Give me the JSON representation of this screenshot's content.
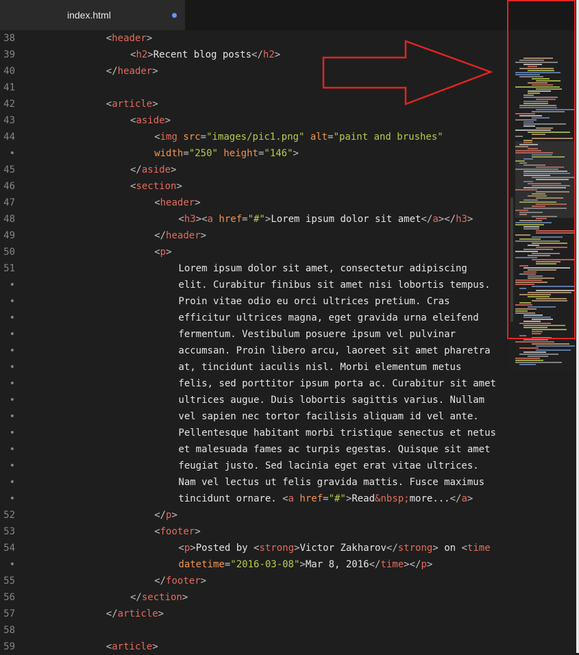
{
  "tab": {
    "filename": "index.html",
    "modified": true
  },
  "lines": [
    {
      "num": "38",
      "indent": 4,
      "tokens": [
        [
          "p",
          "<"
        ],
        [
          "t",
          "header"
        ],
        [
          "p",
          ">"
        ]
      ]
    },
    {
      "num": "39",
      "indent": 5,
      "tokens": [
        [
          "p",
          "<"
        ],
        [
          "t",
          "h2"
        ],
        [
          "p",
          ">"
        ],
        [
          "x",
          "Recent blog posts"
        ],
        [
          "p",
          "</"
        ],
        [
          "t",
          "h2"
        ],
        [
          "p",
          ">"
        ]
      ]
    },
    {
      "num": "40",
      "indent": 4,
      "tokens": [
        [
          "p",
          "</"
        ],
        [
          "t",
          "header"
        ],
        [
          "p",
          ">"
        ]
      ]
    },
    {
      "num": "41",
      "indent": 0,
      "tokens": []
    },
    {
      "num": "42",
      "indent": 4,
      "tokens": [
        [
          "p",
          "<"
        ],
        [
          "t",
          "article"
        ],
        [
          "p",
          ">"
        ]
      ]
    },
    {
      "num": "43",
      "indent": 5,
      "tokens": [
        [
          "p",
          "<"
        ],
        [
          "t",
          "aside"
        ],
        [
          "p",
          ">"
        ]
      ]
    },
    {
      "num": "44",
      "indent": 6,
      "tokens": [
        [
          "p",
          "<"
        ],
        [
          "t",
          "img"
        ],
        [
          "x",
          " "
        ],
        [
          "a",
          "src"
        ],
        [
          "p",
          "="
        ],
        [
          "s",
          "\"images/pic1.png\""
        ],
        [
          "x",
          " "
        ],
        [
          "a",
          "alt"
        ],
        [
          "p",
          "="
        ],
        [
          "s",
          "\"paint and brushes\""
        ]
      ]
    },
    {
      "num": "•",
      "indent": 6,
      "tokens": [
        [
          "a",
          "width"
        ],
        [
          "p",
          "="
        ],
        [
          "s",
          "\"250\""
        ],
        [
          "x",
          " "
        ],
        [
          "a",
          "height"
        ],
        [
          "p",
          "="
        ],
        [
          "s",
          "\"146\""
        ],
        [
          "p",
          ">"
        ]
      ]
    },
    {
      "num": "45",
      "indent": 5,
      "tokens": [
        [
          "p",
          "</"
        ],
        [
          "t",
          "aside"
        ],
        [
          "p",
          ">"
        ]
      ]
    },
    {
      "num": "46",
      "indent": 5,
      "tokens": [
        [
          "p",
          "<"
        ],
        [
          "t",
          "section"
        ],
        [
          "p",
          ">"
        ]
      ]
    },
    {
      "num": "47",
      "indent": 6,
      "tokens": [
        [
          "p",
          "<"
        ],
        [
          "t",
          "header"
        ],
        [
          "p",
          ">"
        ]
      ]
    },
    {
      "num": "48",
      "indent": 7,
      "tokens": [
        [
          "p",
          "<"
        ],
        [
          "t",
          "h3"
        ],
        [
          "p",
          "><"
        ],
        [
          "t",
          "a"
        ],
        [
          "x",
          " "
        ],
        [
          "a",
          "href"
        ],
        [
          "p",
          "="
        ],
        [
          "s",
          "\"#\""
        ],
        [
          "p",
          ">"
        ],
        [
          "x",
          "Lorem ipsum dolor sit amet"
        ],
        [
          "p",
          "</"
        ],
        [
          "t",
          "a"
        ],
        [
          "p",
          "></"
        ],
        [
          "t",
          "h3"
        ],
        [
          "p",
          ">"
        ]
      ]
    },
    {
      "num": "49",
      "indent": 6,
      "tokens": [
        [
          "p",
          "</"
        ],
        [
          "t",
          "header"
        ],
        [
          "p",
          ">"
        ]
      ]
    },
    {
      "num": "50",
      "indent": 6,
      "tokens": [
        [
          "p",
          "<"
        ],
        [
          "t",
          "p"
        ],
        [
          "p",
          ">"
        ]
      ]
    },
    {
      "num": "51",
      "indent": 7,
      "tokens": [
        [
          "x",
          "Lorem ipsum dolor sit amet, consectetur adipiscing"
        ]
      ]
    },
    {
      "num": "•",
      "indent": 7,
      "tokens": [
        [
          "x",
          "elit. Curabitur finibus sit amet nisi lobortis tempus."
        ]
      ]
    },
    {
      "num": "•",
      "indent": 7,
      "tokens": [
        [
          "x",
          "Proin vitae odio eu orci ultrices pretium. Cras"
        ]
      ]
    },
    {
      "num": "•",
      "indent": 7,
      "tokens": [
        [
          "x",
          "efficitur ultrices magna, eget gravida urna eleifend"
        ]
      ]
    },
    {
      "num": "•",
      "indent": 7,
      "tokens": [
        [
          "x",
          "fermentum. Vestibulum posuere ipsum vel pulvinar"
        ]
      ]
    },
    {
      "num": "•",
      "indent": 7,
      "tokens": [
        [
          "x",
          "accumsan. Proin libero arcu, laoreet sit amet pharetra"
        ]
      ]
    },
    {
      "num": "•",
      "indent": 7,
      "tokens": [
        [
          "x",
          "at, tincidunt iaculis nisl. Morbi elementum metus"
        ]
      ]
    },
    {
      "num": "•",
      "indent": 7,
      "tokens": [
        [
          "x",
          "felis, sed porttitor ipsum porta ac. Curabitur sit amet"
        ]
      ]
    },
    {
      "num": "•",
      "indent": 7,
      "tokens": [
        [
          "x",
          "ultrices augue. Duis lobortis sagittis varius. Nullam"
        ]
      ]
    },
    {
      "num": "•",
      "indent": 7,
      "tokens": [
        [
          "x",
          "vel sapien nec tortor facilisis aliquam id vel ante."
        ]
      ]
    },
    {
      "num": "•",
      "indent": 7,
      "tokens": [
        [
          "x",
          "Pellentesque habitant morbi tristique senectus et netus"
        ]
      ]
    },
    {
      "num": "•",
      "indent": 7,
      "tokens": [
        [
          "x",
          "et malesuada fames ac turpis egestas. Quisque sit amet"
        ]
      ]
    },
    {
      "num": "•",
      "indent": 7,
      "tokens": [
        [
          "x",
          "feugiat justo. Sed lacinia eget erat vitae ultrices."
        ]
      ]
    },
    {
      "num": "•",
      "indent": 7,
      "tokens": [
        [
          "x",
          "Nam vel lectus ut felis gravida mattis. Fusce maximus"
        ]
      ]
    },
    {
      "num": "•",
      "indent": 7,
      "tokens": [
        [
          "x",
          "tincidunt ornare. "
        ],
        [
          "p",
          "<"
        ],
        [
          "t",
          "a"
        ],
        [
          "x",
          " "
        ],
        [
          "a",
          "href"
        ],
        [
          "p",
          "="
        ],
        [
          "s",
          "\"#\""
        ],
        [
          "p",
          ">"
        ],
        [
          "x",
          "Read"
        ],
        [
          "e",
          "&nbsp;"
        ],
        [
          "x",
          "more..."
        ],
        [
          "p",
          "</"
        ],
        [
          "t",
          "a"
        ],
        [
          "p",
          ">"
        ]
      ]
    },
    {
      "num": "52",
      "indent": 6,
      "tokens": [
        [
          "p",
          "</"
        ],
        [
          "t",
          "p"
        ],
        [
          "p",
          ">"
        ]
      ]
    },
    {
      "num": "53",
      "indent": 6,
      "tokens": [
        [
          "p",
          "<"
        ],
        [
          "t",
          "footer"
        ],
        [
          "p",
          ">"
        ]
      ]
    },
    {
      "num": "54",
      "indent": 7,
      "tokens": [
        [
          "p",
          "<"
        ],
        [
          "t",
          "p"
        ],
        [
          "p",
          ">"
        ],
        [
          "x",
          "Posted by "
        ],
        [
          "p",
          "<"
        ],
        [
          "t",
          "strong"
        ],
        [
          "p",
          ">"
        ],
        [
          "x",
          "Victor Zakharov"
        ],
        [
          "p",
          "</"
        ],
        [
          "t",
          "strong"
        ],
        [
          "p",
          ">"
        ],
        [
          "x",
          " on "
        ],
        [
          "p",
          "<"
        ],
        [
          "t",
          "time"
        ]
      ]
    },
    {
      "num": "•",
      "indent": 7,
      "tokens": [
        [
          "a",
          "datetime"
        ],
        [
          "p",
          "="
        ],
        [
          "s",
          "\"2016-03-08\""
        ],
        [
          "p",
          ">"
        ],
        [
          "x",
          "Mar 8, 2016"
        ],
        [
          "p",
          "</"
        ],
        [
          "t",
          "time"
        ],
        [
          "p",
          "></"
        ],
        [
          "t",
          "p"
        ],
        [
          "p",
          ">"
        ]
      ]
    },
    {
      "num": "55",
      "indent": 6,
      "tokens": [
        [
          "p",
          "</"
        ],
        [
          "t",
          "footer"
        ],
        [
          "p",
          ">"
        ]
      ]
    },
    {
      "num": "56",
      "indent": 5,
      "tokens": [
        [
          "p",
          "</"
        ],
        [
          "t",
          "section"
        ],
        [
          "p",
          ">"
        ]
      ]
    },
    {
      "num": "57",
      "indent": 4,
      "tokens": [
        [
          "p",
          "</"
        ],
        [
          "t",
          "article"
        ],
        [
          "p",
          ">"
        ]
      ]
    },
    {
      "num": "58",
      "indent": 0,
      "tokens": []
    },
    {
      "num": "59",
      "indent": 4,
      "tokens": [
        [
          "p",
          "<"
        ],
        [
          "t",
          "article"
        ],
        [
          "p",
          ">"
        ]
      ]
    }
  ],
  "colors": {
    "tag": "#e46b5b",
    "attr": "#f2944c",
    "string": "#b6cb4d",
    "text": "#e4e4e4",
    "annotation": "#e12424"
  }
}
